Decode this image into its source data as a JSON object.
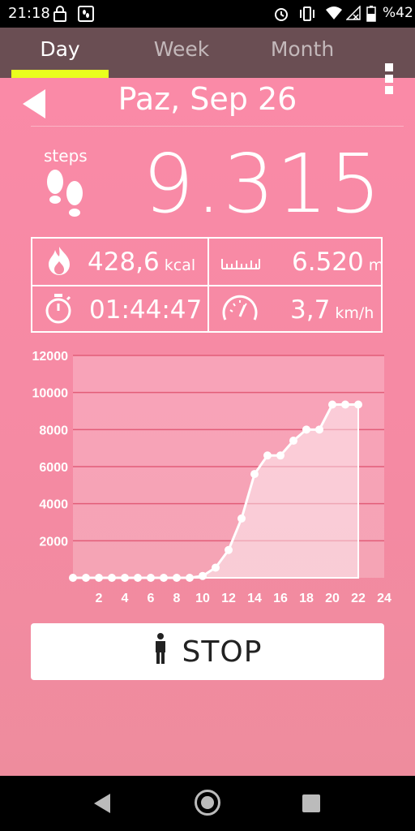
{
  "status_bar": {
    "time": "21:18",
    "battery_percent": "%42",
    "icons": [
      "lock-icon",
      "step-counter-icon",
      "alarm-icon",
      "vibrate-icon",
      "wifi-icon",
      "no-signal-icon",
      "battery-icon"
    ]
  },
  "tabs": [
    {
      "label": "Day",
      "active": true
    },
    {
      "label": "Week",
      "active": false
    },
    {
      "label": "Month",
      "active": false
    }
  ],
  "date": {
    "label": "Paz, Sep 26"
  },
  "steps": {
    "label": "steps",
    "value": "9.315"
  },
  "stats": {
    "calories": {
      "value": "428,6",
      "unit": "kcal"
    },
    "distance": {
      "value": "6.520",
      "unit": "m"
    },
    "duration": {
      "value": "01:44:47",
      "unit": ""
    },
    "speed": {
      "value": "3,7",
      "unit": "km/h"
    }
  },
  "stop_button": {
    "label": "STOP"
  },
  "colors": {
    "accent": "#e9ff1e",
    "tabbar": "#6a4e53",
    "background": "#f78aa6"
  },
  "chart_data": {
    "type": "area",
    "title": "",
    "xlabel": "",
    "ylabel": "",
    "xlim": [
      0,
      24
    ],
    "ylim": [
      0,
      12000
    ],
    "x_ticks": [
      2,
      4,
      6,
      8,
      10,
      12,
      14,
      16,
      18,
      20,
      22,
      24
    ],
    "y_ticks": [
      2000,
      4000,
      6000,
      8000,
      10000,
      12000
    ],
    "grid": true,
    "x": [
      0,
      1,
      2,
      3,
      4,
      5,
      6,
      7,
      8,
      9,
      10,
      11,
      12,
      13,
      14,
      15,
      16,
      17,
      18,
      19,
      20,
      21,
      22
    ],
    "values": [
      0,
      0,
      0,
      0,
      0,
      0,
      0,
      0,
      0,
      0,
      100,
      550,
      1500,
      3200,
      5600,
      6600,
      6600,
      7400,
      8000,
      8000,
      9350,
      9350,
      9350
    ]
  }
}
